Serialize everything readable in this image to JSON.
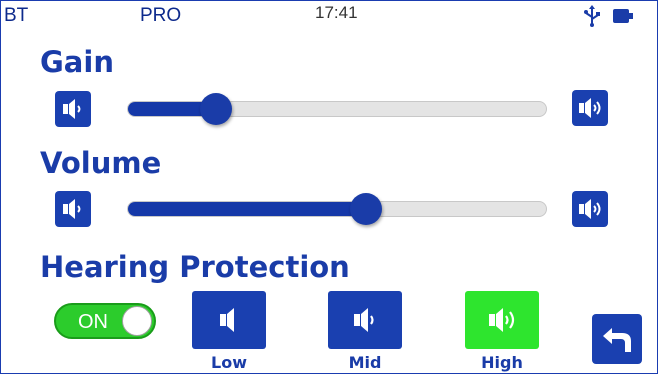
{
  "status_bar": {
    "bluetooth_label": "BT",
    "mode_label": "PRO",
    "time": "17:41",
    "icons": [
      "usb-icon",
      "battery-icon"
    ]
  },
  "gain": {
    "title": "Gain",
    "min_icon": "speaker-low-icon",
    "max_icon": "speaker-high-icon",
    "level_fraction": 0.21
  },
  "volume": {
    "title": "Volume",
    "min_icon": "speaker-low-icon",
    "max_icon": "speaker-high-icon",
    "level_fraction": 0.57
  },
  "hearing_protection": {
    "title": "Hearing Protection",
    "toggle_label": "ON",
    "toggle_on": true,
    "levels": [
      {
        "label": "Low",
        "icon": "speaker-low-icon",
        "selected": false
      },
      {
        "label": "Mid",
        "icon": "speaker-mid-icon",
        "selected": false
      },
      {
        "label": "High",
        "icon": "speaker-high-icon",
        "selected": true
      }
    ]
  },
  "back_icon": "back-arrow-icon",
  "colors": {
    "primary": "#1a40b0",
    "title": "#1a3ca8",
    "accent_on": "#2ccc2c",
    "selected": "#2ee52e",
    "track": "#e4e4e4"
  }
}
